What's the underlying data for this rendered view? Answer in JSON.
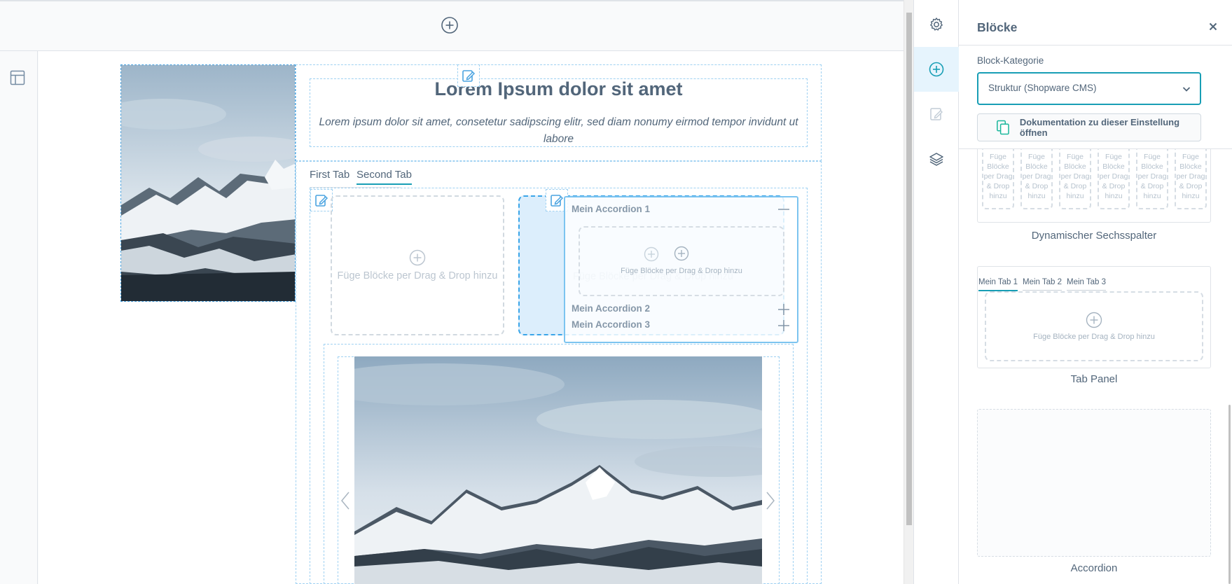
{
  "canvas": {
    "top_add_icon": "plus-circle-icon",
    "layout_icon": "layout-icon",
    "text_block": {
      "headline": "Lorem Ipsum dolor sit amet",
      "lead": "Lorem ipsum dolor sit amet, consetetur sadipscing elitr, sed diam nonumy eirmod tempor invidunt ut labore"
    },
    "tabs": [
      {
        "label": "First Tab"
      },
      {
        "label": "Second Tab",
        "active": true
      }
    ],
    "dropzone_text": "Füge Blöcke per Drag & Drop hinzu",
    "accordion_preview": {
      "items": [
        "Mein Accordion 1",
        "Mein Accordion 2",
        "Mein Accordion 3"
      ],
      "dropzone_text": "Füge Blöcke per Drag & Drop hinzu"
    }
  },
  "sidebar": {
    "rail": [
      {
        "icon": "gear-icon"
      },
      {
        "icon": "plus-circle-icon",
        "active": true
      },
      {
        "icon": "edit-icon",
        "disabled": true
      },
      {
        "icon": "layers-icon"
      }
    ]
  },
  "panel": {
    "title": "Blöcke",
    "category_label": "Block-Kategorie",
    "category_value": "Struktur (Shopware CMS)",
    "doc_button": "Dokumentation zu dieser Einstellung öffnen",
    "six_col_text": "Füge Blöcke per Drag & Drop hinzu",
    "blocks": [
      {
        "name": "Dynamischer Sechsspalter"
      },
      {
        "name": "Tab Panel",
        "tabs": [
          "Mein Tab 1",
          "Mein Tab 2",
          "Mein Tab 3"
        ],
        "dropzone_text": "Füge Blöcke per Drag & Drop hinzu"
      },
      {
        "name": "Accordion"
      }
    ]
  },
  "colors": {
    "accent": "#189eb5",
    "highlight_blue": "#3aa5e8",
    "text": "#52667a",
    "doc_icon": "#1bb79c"
  }
}
